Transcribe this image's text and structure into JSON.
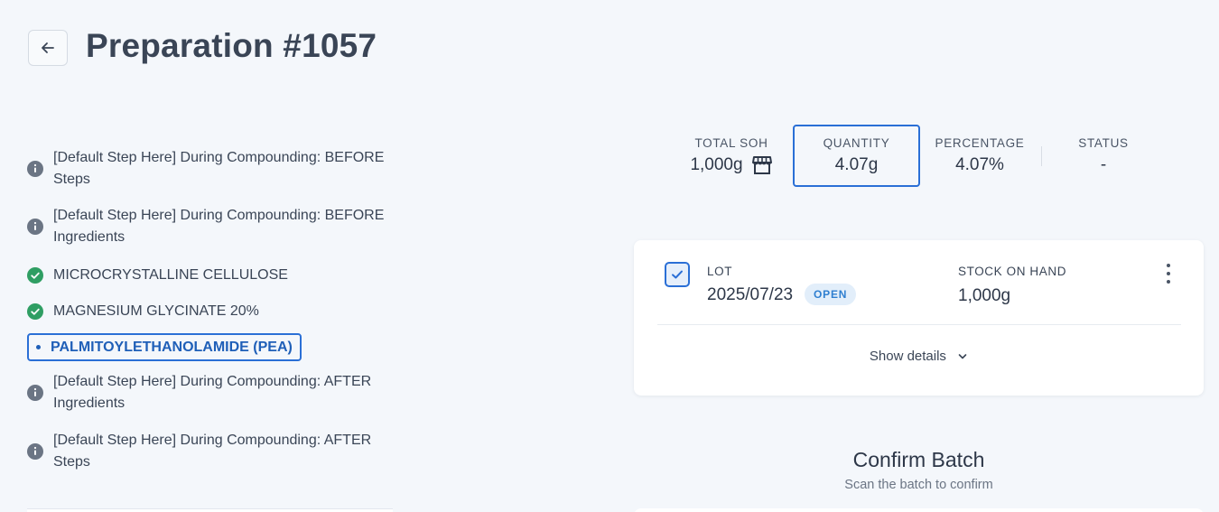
{
  "header": {
    "title": "Preparation #1057",
    "back_icon": "arrow-left-icon"
  },
  "steps": [
    {
      "status": "info",
      "icon": "info-icon",
      "line1": "[Default Step Here] During Compounding: BEFORE",
      "line2": "Steps"
    },
    {
      "status": "info",
      "icon": "info-icon",
      "line1": "[Default Step Here] During Compounding: BEFORE",
      "line2": "Ingredients"
    },
    {
      "status": "done",
      "icon": "check-circle-icon",
      "label": "MICROCRYSTALLINE CELLULOSE"
    },
    {
      "status": "done",
      "icon": "check-circle-icon",
      "label": "MAGNESIUM GLYCINATE 20%"
    },
    {
      "status": "active",
      "icon": "bullet-icon",
      "label": "PALMITOYLETHANOLAMIDE (PEA)"
    },
    {
      "status": "info",
      "icon": "info-icon",
      "line1": "[Default Step Here] During Compounding: AFTER",
      "line2": "Ingredients"
    },
    {
      "status": "info",
      "icon": "info-icon",
      "line1": "[Default Step Here] During Compounding: AFTER",
      "line2": "Steps"
    }
  ],
  "stats": {
    "total_soh": {
      "label": "TOTAL SOH",
      "value": "1,000g",
      "icon": "store-icon"
    },
    "quantity": {
      "label": "QUANTITY",
      "value": "4.07g"
    },
    "percentage": {
      "label": "PERCENTAGE",
      "value": "4.07%"
    },
    "status": {
      "label": "STATUS",
      "value": "-"
    }
  },
  "lot_card": {
    "checked": true,
    "lot_label": "LOT",
    "lot_value": "2025/07/23",
    "badge": "OPEN",
    "soh_label": "STOCK ON HAND",
    "soh_value": "1,000g",
    "show_details": "Show details"
  },
  "confirm": {
    "title": "Confirm Batch",
    "subtitle": "Scan the batch to confirm"
  },
  "colors": {
    "background": "#f4f7fb",
    "accent": "#2a6fd6",
    "success": "#2f9e63",
    "info": "#6b7584",
    "badge_bg": "#e2eefa"
  }
}
